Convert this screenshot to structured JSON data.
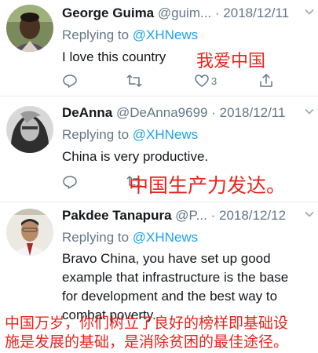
{
  "tweets": [
    {
      "name": "George Guima",
      "handle": "@guim...",
      "separator": "·",
      "date": "2018/12/11",
      "replying_prefix": "Replying to",
      "mention": "@XHNews",
      "text": "I love this country",
      "like_count": "3"
    },
    {
      "name": "DeAnna",
      "handle": "@DeAnna9699",
      "separator": "·",
      "date": "2018/12/11",
      "replying_prefix": "Replying to",
      "mention": "@XHNews",
      "text": "China is very productive."
    },
    {
      "name": "Pakdee Tanapura",
      "handle": "@P...",
      "separator": "·",
      "date": "2018/12/12",
      "replying_prefix": "Replying to",
      "mention": "@XHNews",
      "text_lines": [
        "Bravo China, you have set up good",
        "example that infrastructure is the base",
        "for development and the best way to",
        "combat poverty."
      ]
    }
  ],
  "annotations": {
    "tweet1": "我爱中国",
    "tweet2": "中国生产力发达。",
    "tweet3_line1": "中国万岁，你们树立了良好的榜样即基础设",
    "tweet3_line2": "施是发展的基础，是消除贫困的最佳途径。"
  },
  "colors": {
    "text": "#14171a",
    "secondary": "#657786",
    "link": "#1da1f2",
    "annotation": "#e8231b",
    "divider": "#e6ecf0"
  },
  "icons": [
    "reply-icon",
    "retweet-icon",
    "like-icon",
    "share-icon",
    "chevron-down-icon"
  ]
}
